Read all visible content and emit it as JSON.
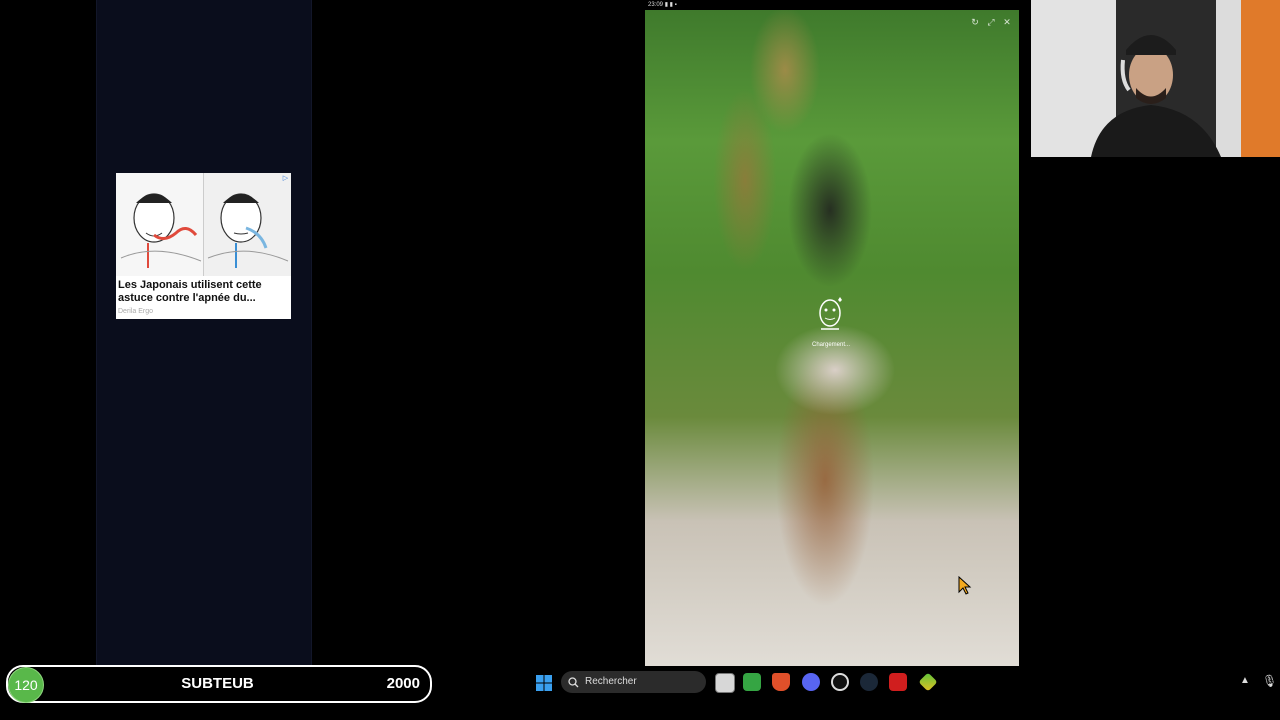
{
  "ad": {
    "title": "Les Japonais utilisent cette astuce contre l'apnée du...",
    "source": "Derila Ergo",
    "badge": "▷"
  },
  "phone": {
    "status_time": "23:09",
    "loading_label": "Chargement...",
    "controls": [
      "refresh-icon",
      "expand-icon",
      "close-icon"
    ]
  },
  "stream_bar": {
    "count": "120",
    "name": "SUBTEUB",
    "goal": "2000"
  },
  "taskbar": {
    "search_placeholder": "Rechercher",
    "pinned_icons": [
      "file-explorer-icon",
      "spreadsheet-app-icon",
      "brave-browser-icon",
      "discord-icon",
      "obs-icon",
      "steam-icon",
      "youtube-icon",
      "stream-app-icon"
    ]
  },
  "colors": {
    "accent_green": "#59b84a",
    "panel_bg": "#0a0d1c"
  }
}
